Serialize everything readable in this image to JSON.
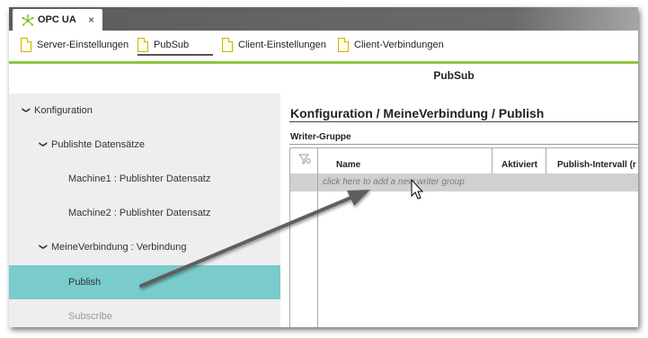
{
  "app_tab": {
    "title": "OPC UA",
    "close_glyph": "×",
    "logo_icon": "opcua-logo-icon",
    "logo_color": "#8dc63f"
  },
  "sub_tabs": [
    {
      "label": "Server-Einstellungen"
    },
    {
      "label": "PubSub"
    },
    {
      "label": "Client-Einstellungen"
    },
    {
      "label": "Client-Verbindungen"
    }
  ],
  "page_title": "PubSub",
  "sidebar": {
    "items": [
      {
        "label": "Konfiguration",
        "chevron": "❯"
      },
      {
        "label": "Publishte Datensätze",
        "chevron": "❯"
      },
      {
        "label": "Machine1 : Publishter Datensatz"
      },
      {
        "label": "Machine2 : Publishter Datensatz"
      },
      {
        "label": "MeineVerbindung : Verbindung",
        "chevron": "❯"
      },
      {
        "label": "Publish"
      },
      {
        "label": "Subscribe"
      }
    ],
    "selected_color": "#79cbcc"
  },
  "main": {
    "breadcrumb": "Konfiguration / MeineVerbindung / Publish",
    "section_title": "Writer-Gruppe",
    "columns": [
      "Name",
      "Aktiviert",
      "Publish-Intervall (r"
    ],
    "new_row_hint": "click here to add a new writer group"
  },
  "accent_color": "#8dc63f"
}
